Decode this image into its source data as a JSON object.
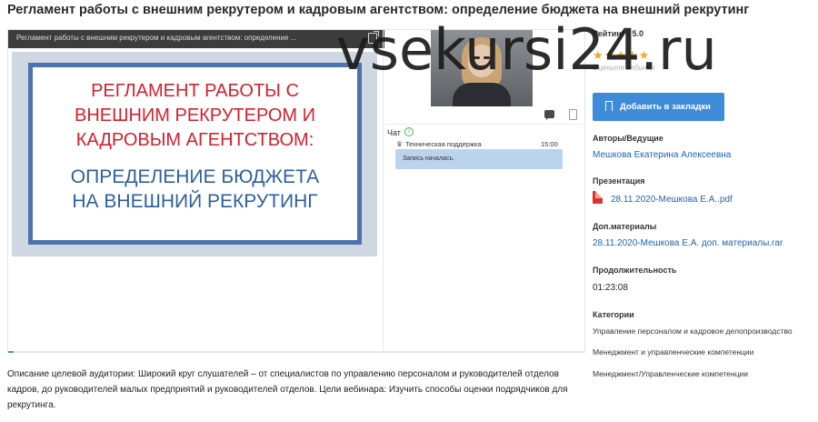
{
  "page": {
    "title": "Регламент работы с внешним рекрутером и кадровым агентством: определение бюджета на внешний рекрутинг",
    "watermark": "vsekursi24.ru"
  },
  "player": {
    "bar_title": "Регламент работы с внешним рекрутером и кадровым агентством: определение ...",
    "slide": {
      "line1": [
        "РЕГЛАМЕНТ РАБОТЫ С",
        "ВНЕШНИМ РЕКРУТЕРОМ И",
        "КАДРОВЫМ АГЕНТСТВОМ:"
      ],
      "line2": [
        "ОПРЕДЕЛЕНИЕ БЮДЖЕТА",
        "НА ВНЕШНИЙ РЕКРУТИНГ"
      ]
    },
    "progress": 0.01
  },
  "chat": {
    "label": "Чат",
    "info_glyph": "i",
    "message": {
      "author": "Техническая поддержка",
      "time": "15:00",
      "text": "Запись началась."
    }
  },
  "description": "Описание целевой аудитории: Широкий круг слушателей – от специалистов по управлению персоналом и руководителей отделов кадров, до руководителей малых предприятий и руководителей отделов. Цели вебинара: Изучить способы оценки подрядчиков для рекрутинга.",
  "sidebar": {
    "rating_label": "Рейтинг - 5.0",
    "stars": 5,
    "rating_hint": "Оцените вебинар",
    "bookmark_label": "Добавить в закладки",
    "authors_label": "Авторы/Ведущие",
    "author_name": "Мешкова Екатерина Алексеевна",
    "presentation_label": "Презентация",
    "presentation_file": "28.11.2020-Мешкова Е.А..pdf",
    "materials_label": "Доп.материалы",
    "materials_file": "28.11.2020-Мешкова Е.А. доп. материалы.rar",
    "duration_label": "Продолжительность",
    "duration_value": "01:23:08",
    "categories_label": "Категории",
    "categories": [
      "Управление персоналом и кадровое делопроизводство",
      "Менеджмент и управленческие компетенции",
      "Менеджмент/Управленческие компетенции"
    ]
  },
  "colors": {
    "accent": "#3d8bd9",
    "link": "#1f63b4",
    "star": "#f5a623",
    "slide_red": "#d4202e",
    "slide_blue": "#2e5f9e"
  }
}
